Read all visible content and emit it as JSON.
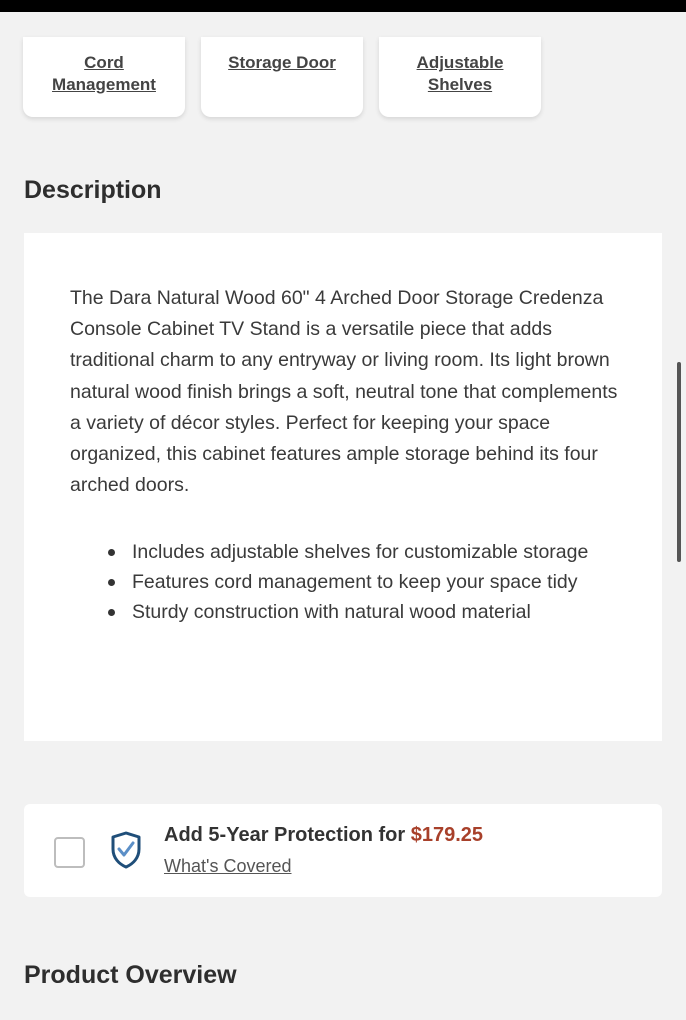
{
  "features": {
    "cord_management": "Cord Management",
    "storage_door": "Storage Door",
    "adjustable_shelves": "Adjustable Shelves"
  },
  "description": {
    "title": "Description",
    "body": "The Dara Natural Wood 60\" 4 Arched Door Storage Credenza Console Cabinet TV Stand is a versatile piece that adds traditional charm to any entryway or living room. Its light brown natural wood finish brings a soft, neutral tone that complements a variety of décor styles. Perfect for keeping your space organized, this cabinet features ample storage behind its four arched doors.",
    "bullets": [
      "Includes adjustable shelves for customizable storage",
      "Features cord management to keep your space tidy",
      "Sturdy construction with natural wood material"
    ]
  },
  "protection": {
    "label": "Add 5-Year Protection for",
    "price": "$179.25",
    "covered_link": "What's Covered",
    "icon": "shield-check-icon",
    "checked": false,
    "price_color": "#a8402a",
    "icon_color": "#1f4e79"
  },
  "overview": {
    "title": "Product Overview"
  }
}
